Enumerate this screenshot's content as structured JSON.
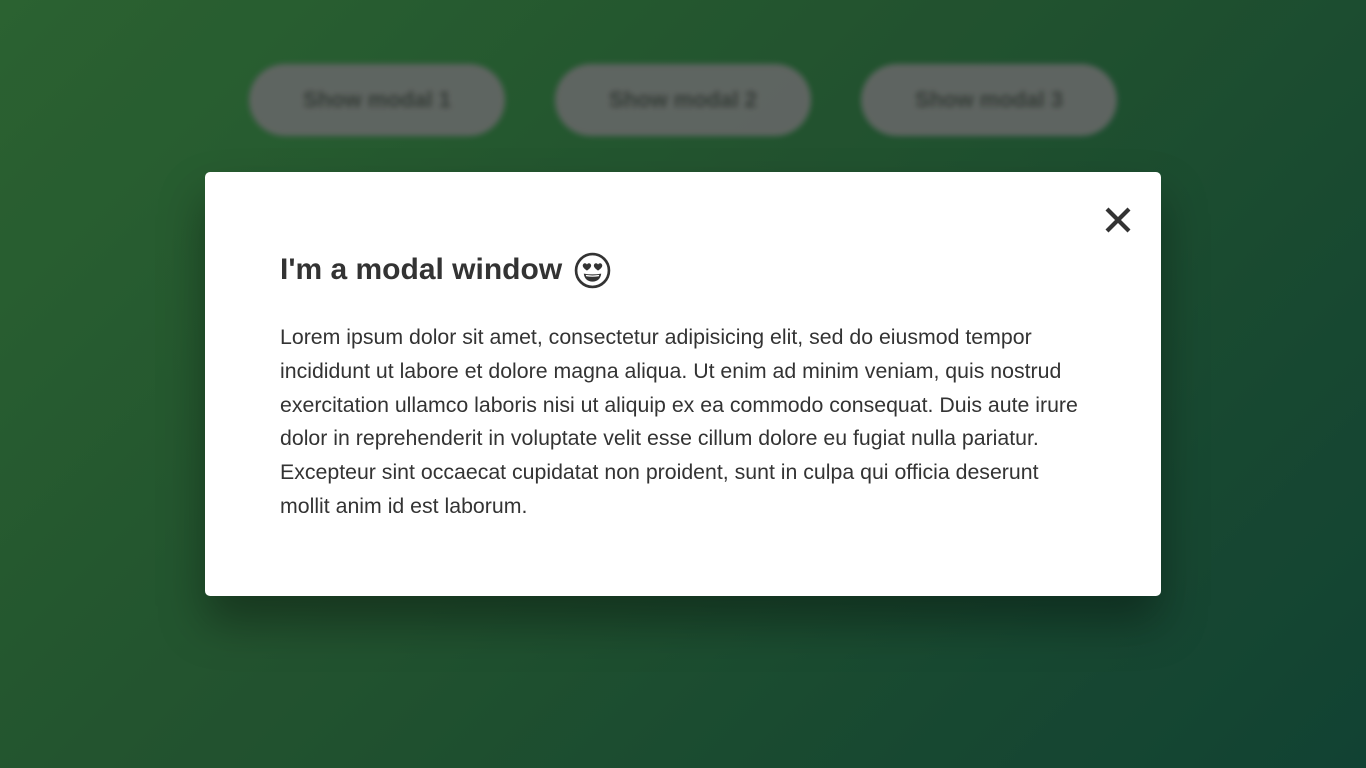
{
  "background_buttons": [
    {
      "label": "Show modal 1"
    },
    {
      "label": "Show modal 2"
    },
    {
      "label": "Show modal 3"
    }
  ],
  "modal": {
    "title": "I'm a modal window",
    "title_emoji": "smiling-face-heart-eyes-icon",
    "body": "Lorem ipsum dolor sit amet, consectetur adipisicing elit, sed do eiusmod tempor incididunt ut labore et dolore magna aliqua. Ut enim ad minim veniam, quis nostrud exercitation ullamco laboris nisi ut aliquip ex ea commodo consequat. Duis aute irure dolor in reprehenderit in voluptate velit esse cillum dolore eu fugiat nulla pariatur. Excepteur sint occaecat cupidatat non proident, sunt in culpa qui officia deserunt mollit anim id est laborum.",
    "close_icon": "close-icon"
  },
  "colors": {
    "background_start": "#2f6b36",
    "background_end": "#134838",
    "modal_bg": "#ffffff",
    "text": "#333333",
    "button_bg": "#6b6f6d"
  }
}
